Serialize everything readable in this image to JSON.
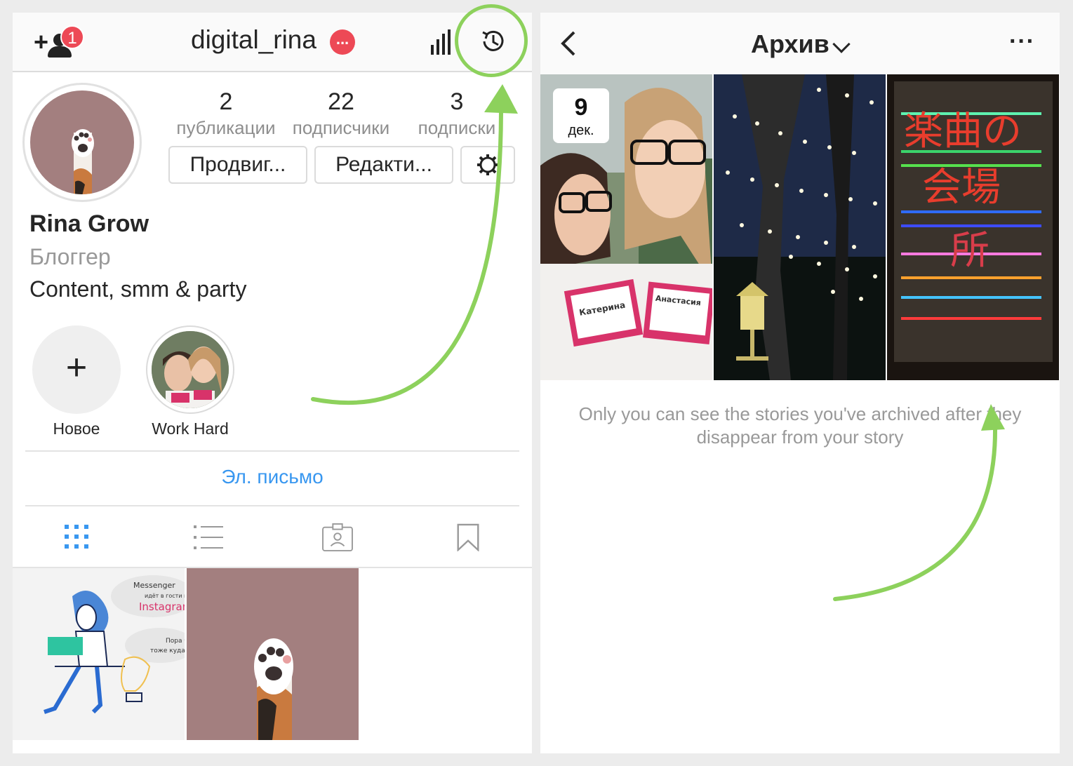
{
  "profile": {
    "username": "digital_rina",
    "notification_badge": "1",
    "username_badge": "...",
    "stats": [
      {
        "value": "2",
        "label": "публикации"
      },
      {
        "value": "22",
        "label": "подписчики"
      },
      {
        "value": "3",
        "label": "подписки"
      }
    ],
    "buttons": {
      "promote": "Продвиг...",
      "edit": "Редакти..."
    },
    "name": "Rina Grow",
    "category": "Блоггер",
    "bio": "Content, smm & party",
    "highlights": [
      {
        "label": "Новое",
        "icon": "+"
      },
      {
        "label": "Work Hard"
      }
    ],
    "email_link": "Эл. письмо",
    "grid_post_texts": {
      "line1": "Messenger",
      "line2": "идёт в гости к",
      "line3": "Instagram",
      "line4": "Пора б",
      "line5": "тоже куда-т"
    }
  },
  "archive": {
    "title": "Архив",
    "more": "···",
    "date_day": "9",
    "date_month": "дек.",
    "note": "Only you can see the stories you've archived after they disappear from your story",
    "story_sign": {
      "line1": "楽曲の",
      "line2": "会場",
      "line3": "所"
    },
    "badge_names": [
      "Катерина",
      "Анастасия"
    ]
  },
  "colors": {
    "accent_blue": "#3897f0",
    "badge_red": "#ed4956",
    "highlight_green": "#8dd15c",
    "avatar_bg": "#a37f7f"
  }
}
